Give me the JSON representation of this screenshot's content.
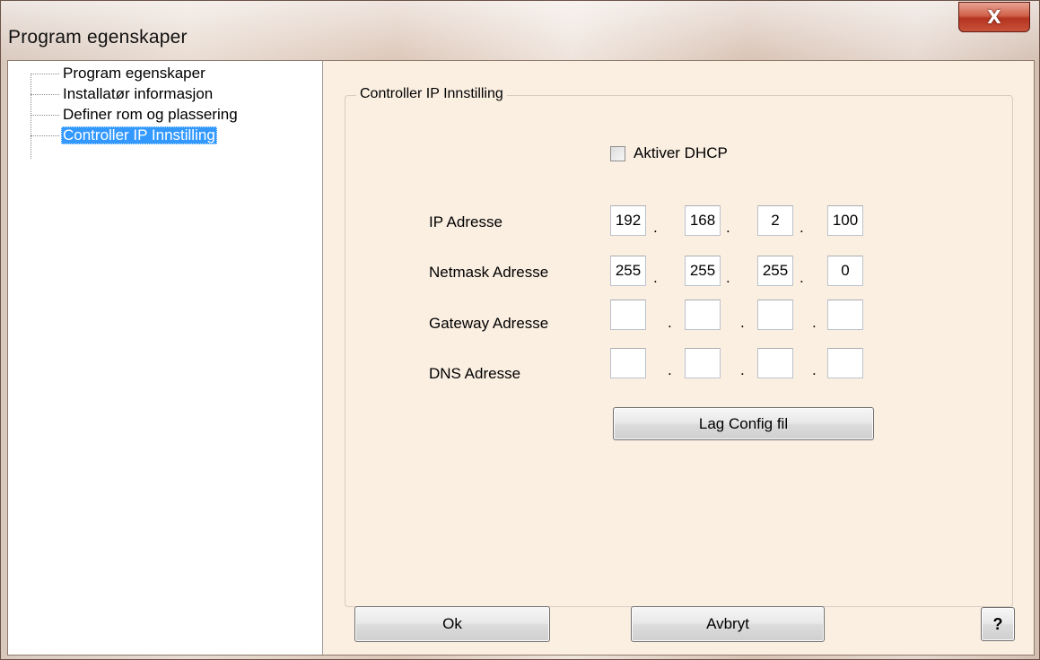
{
  "window": {
    "title": "Program egenskaper",
    "close_glyph": "X"
  },
  "tree": {
    "items": [
      {
        "label": "Program egenskaper"
      },
      {
        "label": "Installatør informasjon"
      },
      {
        "label": "Definer rom og plassering"
      },
      {
        "label": "Controller IP Innstilling",
        "selected": true
      }
    ]
  },
  "panel": {
    "group_title": "Controller IP Innstilling",
    "dhcp_label": "Aktiver DHCP",
    "dhcp_checked": false,
    "rows": [
      {
        "label": "IP Adresse",
        "octets": [
          "192",
          "168",
          "2",
          "100"
        ]
      },
      {
        "label": "Netmask Adresse",
        "octets": [
          "255",
          "255",
          "255",
          "0"
        ]
      },
      {
        "label": "Gateway Adresse",
        "octets": [
          "",
          "",
          "",
          ""
        ]
      },
      {
        "label": "DNS Adresse",
        "octets": [
          "",
          "",
          "",
          ""
        ]
      }
    ],
    "config_button": "Lag Config fil"
  },
  "footer": {
    "ok": "Ok",
    "cancel": "Avbryt",
    "help": "?"
  },
  "colors": {
    "selection": "#3399ff",
    "panel_bg": "#fbefe2",
    "close_red": "#c8523a"
  },
  "icons": {
    "close": "close-icon",
    "help": "help-icon"
  }
}
